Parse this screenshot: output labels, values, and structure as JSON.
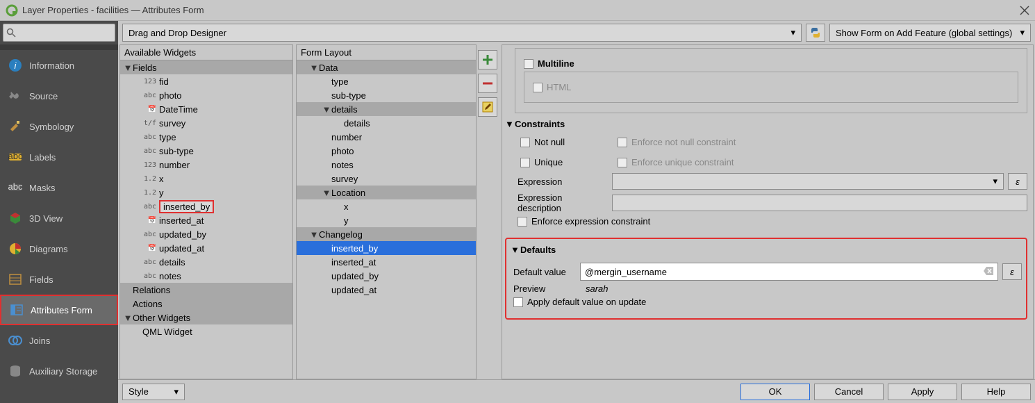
{
  "window": {
    "title": "Layer Properties - facilities — Attributes Form"
  },
  "sidebar": {
    "items": [
      {
        "label": "Information",
        "icon": "info"
      },
      {
        "label": "Source",
        "icon": "wrench"
      },
      {
        "label": "Symbology",
        "icon": "brush"
      },
      {
        "label": "Labels",
        "icon": "abc"
      },
      {
        "label": "Masks",
        "icon": "abc-dark"
      },
      {
        "label": "3D View",
        "icon": "cube"
      },
      {
        "label": "Diagrams",
        "icon": "pie"
      },
      {
        "label": "Fields",
        "icon": "table"
      },
      {
        "label": "Attributes Form",
        "icon": "form"
      },
      {
        "label": "Joins",
        "icon": "join"
      },
      {
        "label": "Auxiliary Storage",
        "icon": "db"
      }
    ],
    "selected_index": 8
  },
  "top": {
    "designer": "Drag and Drop Designer",
    "show_form": "Show Form on Add Feature (global settings)"
  },
  "available": {
    "title": "Available Widgets",
    "fields_label": "Fields",
    "fields": [
      {
        "t": "123",
        "n": "fid"
      },
      {
        "t": "abc",
        "n": "photo"
      },
      {
        "t": "cal",
        "n": "DateTime"
      },
      {
        "t": "t/f",
        "n": "survey"
      },
      {
        "t": "abc",
        "n": "type"
      },
      {
        "t": "abc",
        "n": "sub-type"
      },
      {
        "t": "123",
        "n": "number"
      },
      {
        "t": "1.2",
        "n": "x"
      },
      {
        "t": "1.2",
        "n": "y"
      },
      {
        "t": "abc",
        "n": "inserted_by"
      },
      {
        "t": "cal",
        "n": "inserted_at"
      },
      {
        "t": "abc",
        "n": "updated_by"
      },
      {
        "t": "cal",
        "n": "updated_at"
      },
      {
        "t": "abc",
        "n": "details"
      },
      {
        "t": "abc",
        "n": "notes"
      }
    ],
    "relations": "Relations",
    "actions": "Actions",
    "other_widgets": "Other Widgets",
    "qml_widget": "QML Widget",
    "highlight_index": 9
  },
  "layout": {
    "title": "Form Layout",
    "tree": [
      {
        "lvl": 0,
        "exp": "d",
        "label": "Data",
        "group": true
      },
      {
        "lvl": 1,
        "exp": "",
        "label": "type"
      },
      {
        "lvl": 1,
        "exp": "",
        "label": "sub-type"
      },
      {
        "lvl": 1,
        "exp": "d",
        "label": "details",
        "group": true
      },
      {
        "lvl": 2,
        "exp": "",
        "label": "details"
      },
      {
        "lvl": 1,
        "exp": "",
        "label": "number"
      },
      {
        "lvl": 1,
        "exp": "",
        "label": "photo"
      },
      {
        "lvl": 1,
        "exp": "",
        "label": "notes"
      },
      {
        "lvl": 1,
        "exp": "",
        "label": "survey"
      },
      {
        "lvl": 1,
        "exp": "d",
        "label": "Location",
        "group": true
      },
      {
        "lvl": 2,
        "exp": "",
        "label": "x"
      },
      {
        "lvl": 2,
        "exp": "",
        "label": "y"
      },
      {
        "lvl": 0,
        "exp": "d",
        "label": "Changelog",
        "group": true
      },
      {
        "lvl": 1,
        "exp": "",
        "label": "inserted_by",
        "sel": true
      },
      {
        "lvl": 1,
        "exp": "",
        "label": "inserted_at"
      },
      {
        "lvl": 1,
        "exp": "",
        "label": "updated_by"
      },
      {
        "lvl": 1,
        "exp": "",
        "label": "updated_at"
      }
    ]
  },
  "right": {
    "multiline": "Multiline",
    "html": "HTML",
    "constraints": {
      "title": "Constraints",
      "not_null": "Not null",
      "enforce_nn": "Enforce not null constraint",
      "unique": "Unique",
      "enforce_u": "Enforce unique constraint",
      "expression": "Expression",
      "expr_desc": "Expression description",
      "enforce_expr": "Enforce expression constraint"
    },
    "defaults": {
      "title": "Defaults",
      "default_value_label": "Default value",
      "default_value": "@mergin_username",
      "preview_label": "Preview",
      "preview_value": "sarah",
      "apply_on_update": "Apply default value on update"
    }
  },
  "footer": {
    "style": "Style",
    "ok": "OK",
    "cancel": "Cancel",
    "apply": "Apply",
    "help": "Help"
  }
}
